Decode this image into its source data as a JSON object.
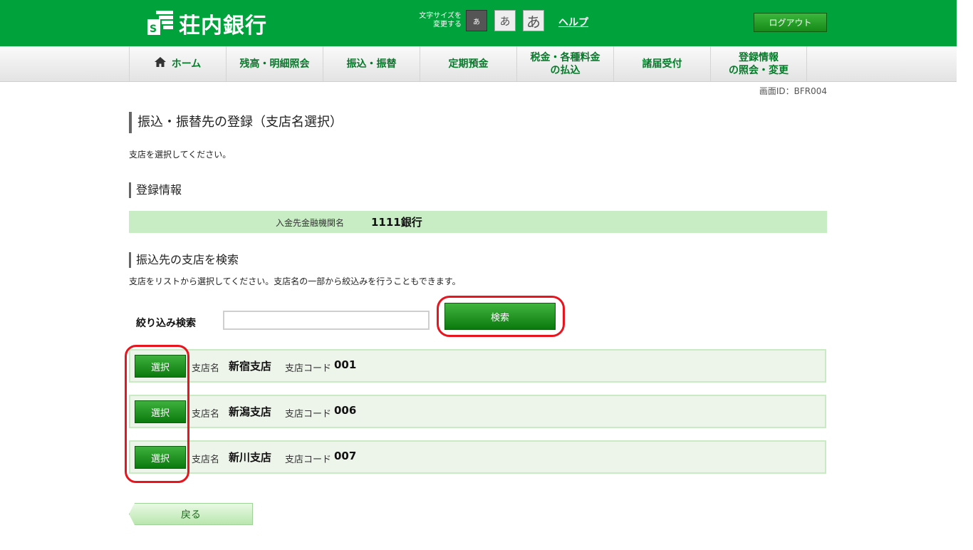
{
  "header": {
    "bank_name": "荘内銀行",
    "font_size_label_line1": "文字サイズを",
    "font_size_label_line2": "変更する",
    "font_size_options": [
      "あ",
      "あ",
      "あ"
    ],
    "help_label": "ヘルプ",
    "logout_label": "ログアウト",
    "brand_color": "#00a23c"
  },
  "nav": {
    "items": [
      {
        "label": "ホーム",
        "icon": "home-icon"
      },
      {
        "label": "残高・明細照会"
      },
      {
        "label": "振込・振替"
      },
      {
        "label": "定期預金"
      },
      {
        "label_line1": "税金・各種料金",
        "label_line2": "の払込"
      },
      {
        "label": "諸届受付"
      },
      {
        "label_line1": "登録情報",
        "label_line2": "の照会・変更"
      }
    ]
  },
  "screen_id": "画面ID：BFR004",
  "page": {
    "title": "振込・振替先の登録（支店名選択）",
    "instruction": "支店を選択してください。"
  },
  "registration": {
    "heading": "登録情報",
    "bank_label": "入金先金融機関名",
    "bank_value": "1111銀行"
  },
  "search": {
    "heading": "振込先の支店を検索",
    "description": "支店をリストから選択してください。支店名の一部から絞込みを行うこともできます。",
    "filter_label": "絞り込み検索",
    "filter_value": "",
    "search_button": "検索"
  },
  "branches": [
    {
      "select_label": "選択",
      "name_label": "支店名",
      "name": "新宿支店",
      "code_label": "支店コード",
      "code": "001"
    },
    {
      "select_label": "選択",
      "name_label": "支店名",
      "name": "新潟支店",
      "code_label": "支店コード",
      "code": "006"
    },
    {
      "select_label": "選択",
      "name_label": "支店名",
      "name": "新川支店",
      "code_label": "支店コード",
      "code": "007"
    }
  ],
  "back_button": "戻る",
  "highlight_color": "#e8141e"
}
